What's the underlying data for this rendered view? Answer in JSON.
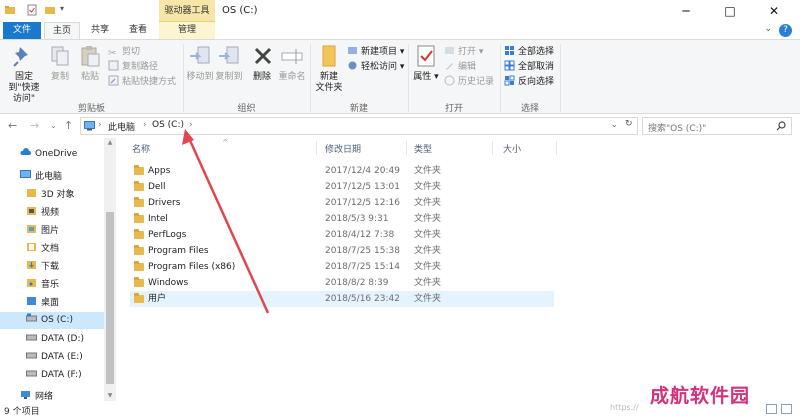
{
  "window": {
    "title": "OS (C:)",
    "context_tab_group": "驱动器工具",
    "minimize": "─",
    "maximize": "□",
    "close": "✕"
  },
  "tabs": {
    "file": "文件",
    "home": "主页",
    "share": "共享",
    "view": "查看",
    "manage": "管理"
  },
  "ribbon": {
    "clipboard": {
      "label": "剪贴板",
      "pin": "固定到\"快速访问\"",
      "copy": "复制",
      "paste": "粘贴",
      "cut": "剪切",
      "copy_path": "复制路径",
      "paste_shortcut": "粘贴快捷方式"
    },
    "organize": {
      "label": "组织",
      "move_to": "移动到",
      "copy_to": "复制到",
      "delete": "删除",
      "rename": "重命名"
    },
    "new": {
      "label": "新建",
      "new_folder": "新建\n文件夹",
      "new_item": "新建项目",
      "easy_access": "轻松访问"
    },
    "open": {
      "label": "打开",
      "properties": "属性",
      "open": "打开",
      "edit": "编辑",
      "history": "历史记录"
    },
    "select": {
      "label": "选择",
      "select_all": "全部选择",
      "select_none": "全部取消",
      "invert": "反向选择"
    }
  },
  "address": {
    "crumbs": [
      "此电脑",
      "OS (C:)"
    ],
    "search_placeholder": "搜索\"OS (C:)\""
  },
  "nav": [
    {
      "label": "OneDrive",
      "icon": "cloud-icon"
    },
    {
      "label": "此电脑",
      "icon": "computer-icon"
    },
    {
      "label": "3D 对象",
      "icon": "3d-objects-icon"
    },
    {
      "label": "视频",
      "icon": "video-icon"
    },
    {
      "label": "图片",
      "icon": "pictures-icon"
    },
    {
      "label": "文档",
      "icon": "documents-icon"
    },
    {
      "label": "下载",
      "icon": "downloads-icon"
    },
    {
      "label": "音乐",
      "icon": "music-icon"
    },
    {
      "label": "桌面",
      "icon": "desktop-icon"
    },
    {
      "label": "OS (C:)",
      "icon": "drive-icon"
    },
    {
      "label": "DATA (D:)",
      "icon": "drive-icon"
    },
    {
      "label": "DATA (E:)",
      "icon": "drive-icon"
    },
    {
      "label": "DATA (F:)",
      "icon": "drive-icon"
    },
    {
      "label": "网络",
      "icon": "network-icon"
    }
  ],
  "columns": {
    "name": "名称",
    "date": "修改日期",
    "type": "类型",
    "size": "大小"
  },
  "files": [
    {
      "name": "Apps",
      "date": "2017/12/4 20:49",
      "type": "文件夹"
    },
    {
      "name": "Dell",
      "date": "2017/12/5 13:01",
      "type": "文件夹"
    },
    {
      "name": "Drivers",
      "date": "2017/12/5 12:16",
      "type": "文件夹"
    },
    {
      "name": "Intel",
      "date": "2018/5/3 9:31",
      "type": "文件夹"
    },
    {
      "name": "PerfLogs",
      "date": "2018/4/12 7:38",
      "type": "文件夹"
    },
    {
      "name": "Program Files",
      "date": "2018/7/25 15:38",
      "type": "文件夹"
    },
    {
      "name": "Program Files (x86)",
      "date": "2018/7/25 15:14",
      "type": "文件夹"
    },
    {
      "name": "Windows",
      "date": "2018/8/2 8:39",
      "type": "文件夹"
    },
    {
      "name": "用户",
      "date": "2018/5/16 23:42",
      "type": "文件夹"
    }
  ],
  "status": {
    "count": "9 个项目"
  },
  "watermark": {
    "text": "成航软件园",
    "url": "https://"
  },
  "colors": {
    "accent": "#1979ca",
    "annotation_arrow": "#e0474c",
    "selected_nav": "#cce8ff",
    "watermark": "#d2317c"
  }
}
